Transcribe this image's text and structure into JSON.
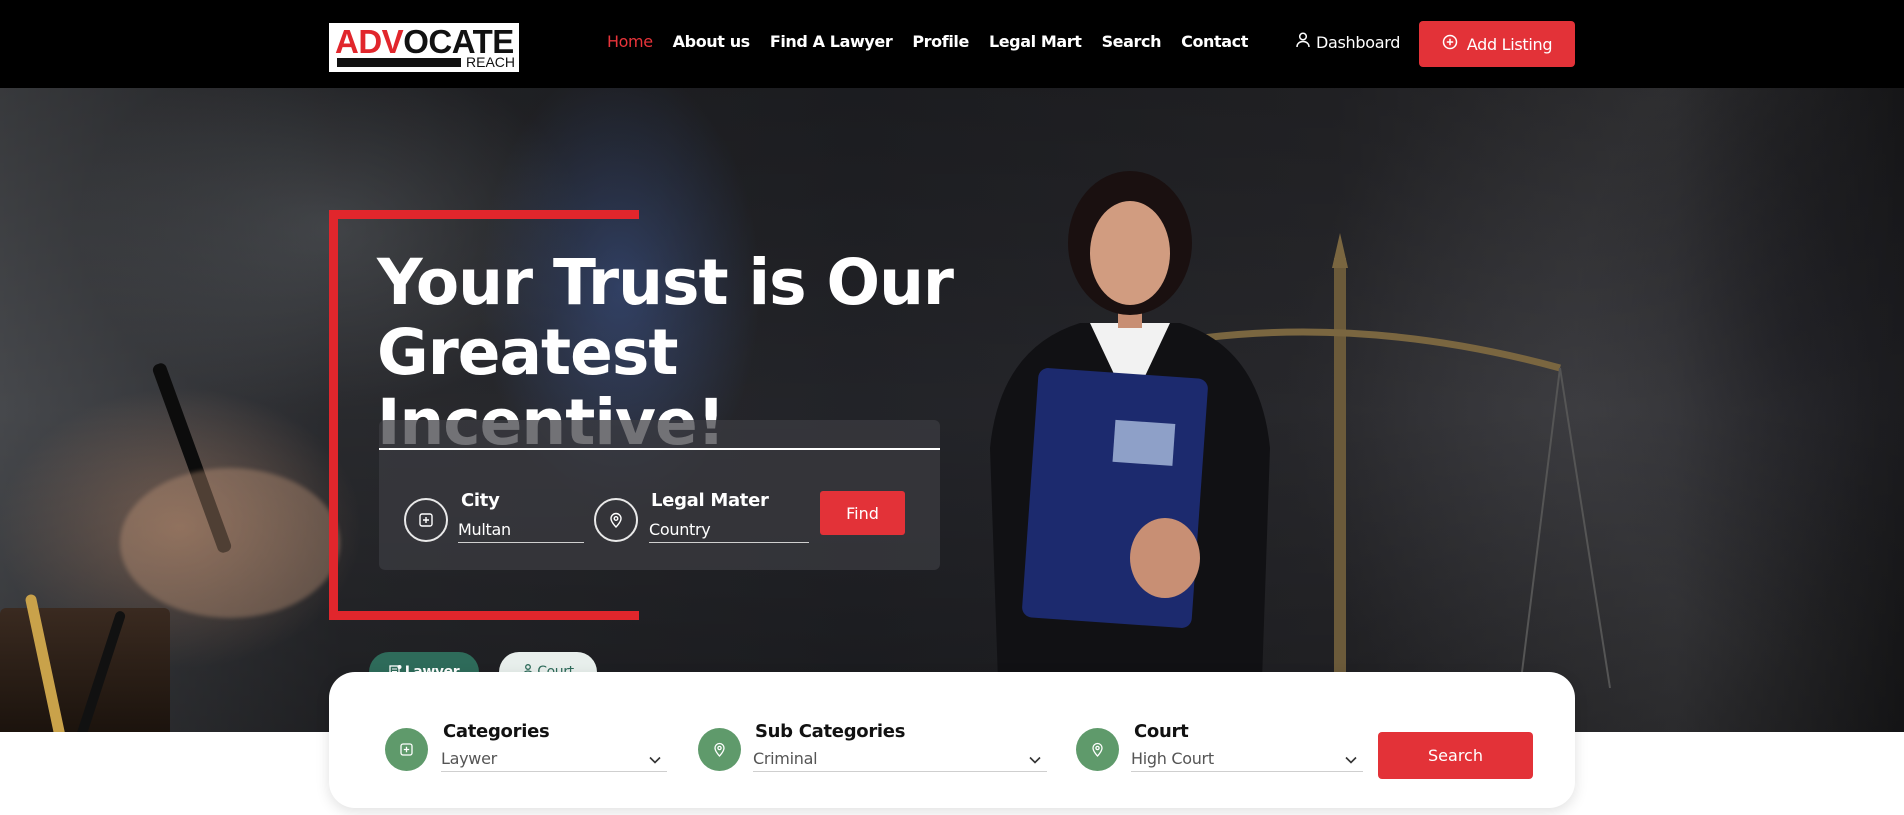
{
  "logo": {
    "part1": "ADV",
    "part2": "OCATE",
    "sub": "REACH"
  },
  "nav": {
    "items": [
      "Home",
      "About us",
      "Find A Lawyer",
      "Profile",
      "Legal Mart",
      "Search",
      "Contact"
    ],
    "active": "Home"
  },
  "header": {
    "dashboard_label": "Dashboard",
    "add_listing_label": "Add Listing"
  },
  "hero": {
    "headline_line1": "Your Trust is Our",
    "headline_line2": "Greatest Incentive!",
    "city": {
      "label": "City",
      "value": "Multan"
    },
    "legal_matter": {
      "label": "Legal Mater",
      "value": "Country"
    },
    "find_label": "Find"
  },
  "tabs": [
    {
      "label": "Lawyer",
      "active": true
    },
    {
      "label": "Court",
      "active": false
    }
  ],
  "filters": {
    "categories": {
      "label": "Categories",
      "value": "Laywer"
    },
    "sub_categories": {
      "label": "Sub Categories",
      "value": "Criminal"
    },
    "court": {
      "label": "Court",
      "value": "High Court"
    },
    "search_label": "Search"
  },
  "colors": {
    "accent_red": "#e33238",
    "tab_green": "#2e6b5a",
    "icon_green": "#5f9a6b",
    "header_bg": "#000000"
  }
}
